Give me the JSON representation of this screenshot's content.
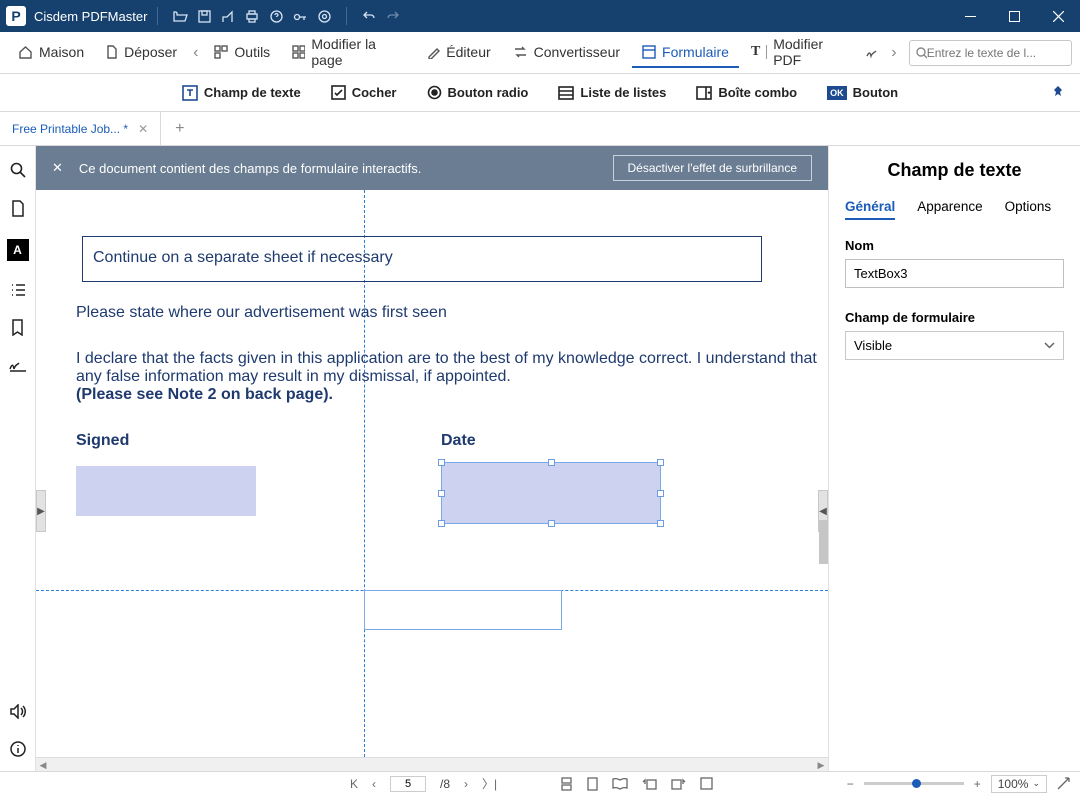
{
  "app": {
    "title": "Cisdem PDFMaster"
  },
  "menu": {
    "home": "Maison",
    "file": "Déposer",
    "tools": "Outils",
    "editpage": "Modifier la page",
    "editor": "Éditeur",
    "converter": "Convertisseur",
    "form": "Formulaire",
    "editpdf": "Modifier PDF"
  },
  "search": {
    "placeholder": "Entrez le texte de l..."
  },
  "toolbar": {
    "textfield": "Champ de texte",
    "check": "Cocher",
    "radio": "Bouton radio",
    "listbox": "Liste de listes",
    "combo": "Boîte combo",
    "button": "Bouton"
  },
  "tab": {
    "name": "Free Printable Job... *"
  },
  "banner": {
    "msg": "Ce document contient des champs de formulaire interactifs.",
    "action": "Désactiver l'effet de surbrillance"
  },
  "doc": {
    "continue": "Continue on a separate sheet if necessary",
    "ad": "Please state where our advertisement was first seen",
    "decl1": "I declare that the facts given in this application are to the best of my knowledge correct.  I understand that any false information may result in my dismissal, if appointed.",
    "decl2": "(Please see Note 2 on back page).",
    "signed": "Signed",
    "date": "Date"
  },
  "panel": {
    "title": "Champ de texte",
    "tabs": {
      "general": "Général",
      "appearance": "Apparence",
      "options": "Options"
    },
    "name_label": "Nom",
    "name_value": "TextBox3",
    "field_label": "Champ de formulaire",
    "visibility": "Visible"
  },
  "status": {
    "page_current": "5",
    "page_total": "/8",
    "zoom": "100%"
  }
}
